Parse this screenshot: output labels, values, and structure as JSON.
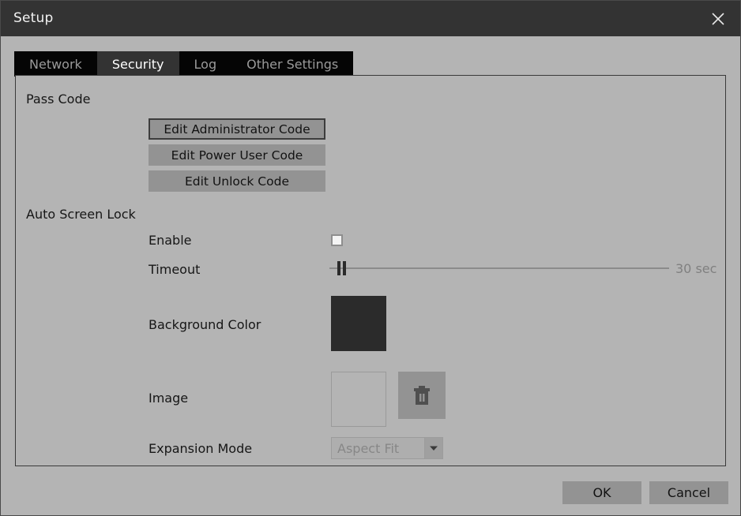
{
  "window": {
    "title": "Setup",
    "close_icon": "close-icon"
  },
  "tabs": [
    {
      "label": "Network",
      "active": false
    },
    {
      "label": "Security",
      "active": true
    },
    {
      "label": "Log",
      "active": false
    },
    {
      "label": "Other Settings",
      "active": false
    }
  ],
  "sections": {
    "pass_code": {
      "title": "Pass Code",
      "buttons": [
        {
          "label": "Edit Administrator Code",
          "focused": true
        },
        {
          "label": "Edit Power User Code",
          "focused": false
        },
        {
          "label": "Edit Unlock Code",
          "focused": false
        }
      ]
    },
    "auto_screen_lock": {
      "title": "Auto Screen Lock",
      "enable": {
        "label": "Enable",
        "checked": false
      },
      "timeout": {
        "label": "Timeout",
        "value_text": "30 sec",
        "handle_position_pct": 2
      },
      "background_color": {
        "label": "Background Color",
        "swatch_hex": "#2b2b2b"
      },
      "image": {
        "label": "Image",
        "preview_empty": true,
        "delete_icon": "trash-icon"
      },
      "expansion_mode": {
        "label": "Expansion Mode",
        "value": "Aspect Fit",
        "disabled": true,
        "arrow_icon": "chevron-down-icon"
      }
    }
  },
  "footer": {
    "ok_label": "OK",
    "cancel_label": "Cancel"
  },
  "colors": {
    "window_background": "#b4b4b4",
    "titlebar": "#333333",
    "tab_inactive": "#050505",
    "tab_active": "#333333",
    "button_face": "#939393",
    "accent_text": "#161616"
  }
}
